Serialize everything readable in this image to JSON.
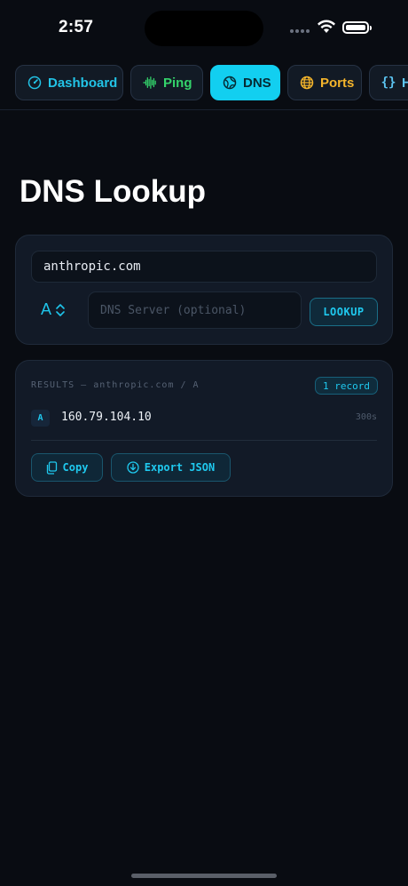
{
  "status_bar": {
    "time": "2:57"
  },
  "tabs": [
    {
      "label": "Dashboard",
      "icon": "gauge-icon",
      "color": "#22c3e6"
    },
    {
      "label": "Ping",
      "icon": "waveform-icon",
      "color": "#34d36b"
    },
    {
      "label": "DNS",
      "icon": "globe-icon",
      "color": "#12cff0",
      "selected": true
    },
    {
      "label": "Ports",
      "icon": "network-globe-icon",
      "color": "#f5b52b"
    },
    {
      "label": "H",
      "icon": "braces-icon",
      "color": "#5cc5f2"
    }
  ],
  "page": {
    "title": "DNS Lookup"
  },
  "lookup": {
    "domain_value": "anthropic.com",
    "record_type": "A",
    "server_placeholder": "DNS Server (optional)",
    "button_label": "LOOKUP"
  },
  "results": {
    "header": "RESULTS — anthropic.com / A",
    "badge": "1 record",
    "records": [
      {
        "type": "A",
        "value": "160.79.104.10",
        "ttl": "300s"
      }
    ],
    "copy_label": "Copy",
    "export_label": "Export JSON"
  }
}
